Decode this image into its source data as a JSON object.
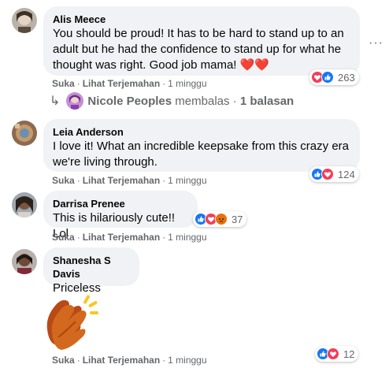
{
  "comments": [
    {
      "author": "Alis Meece",
      "text_lines": [
        "You should be proud! It has to be hard to stand up to an",
        "adult but he had the confidence to stand up for what he",
        "thought was right. Good job mama! ❤️❤️"
      ],
      "reaction_count": "263",
      "actions": {
        "like": "Suka",
        "translate": "Lihat Terjemahan",
        "time": "1 minggu"
      }
    },
    {
      "author": "Leia Anderson",
      "text_lines": [
        "I love it! What an incredible keepsake from this crazy era",
        "we're living through."
      ],
      "reaction_count": "124",
      "actions": {
        "like": "Suka",
        "translate": "Lihat Terjemahan",
        "time": "1 minggu"
      }
    },
    {
      "author": "Darrisa Prenee",
      "text_lines": [
        "This is hilariously cute!! Lol"
      ],
      "reaction_count": "37",
      "actions": {
        "like": "Suka",
        "translate": "Lihat Terjemahan",
        "time": "1 minggu"
      }
    },
    {
      "author": "Shanesha S Davis",
      "text_lines": [
        "Priceless"
      ],
      "reaction_count": "12",
      "actions": {
        "like": "Suka",
        "translate": "Lihat Terjemahan",
        "time": "1 minggu"
      }
    }
  ],
  "reply": {
    "name": "Nicole Peoples",
    "text": "membalas",
    "separator": "·",
    "count_text": "1 balasan"
  },
  "more_menu": "···",
  "icons": {
    "like": "like-reaction-icon",
    "love": "love-reaction-icon",
    "haha": "haha-reaction-icon",
    "clap": "clapping-hands-sticker"
  },
  "colors": {
    "bubble": "#f0f2f5",
    "secondary_text": "#65676b",
    "like_blue": "#1877f2",
    "love_red": "#f33e58",
    "haha_yellow": "#f7b125"
  }
}
